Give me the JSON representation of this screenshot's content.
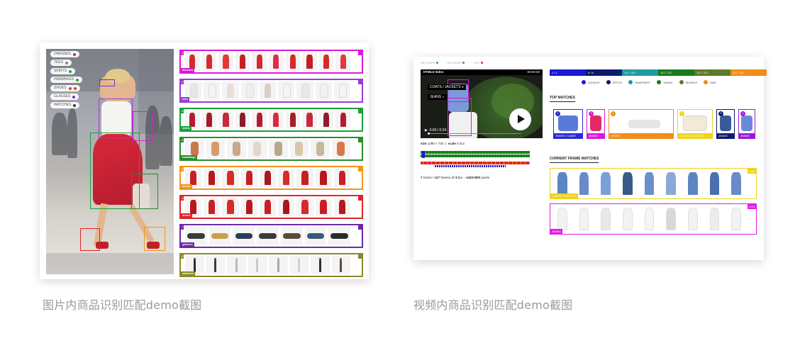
{
  "captions": {
    "image_demo": "图片内商品识别匹配demo截图",
    "video_demo": "视频内商品识别匹配demo截图"
  },
  "image_demo": {
    "tags": [
      {
        "label": "DRESSES",
        "color": "#e0157a"
      },
      {
        "label": "TEES",
        "color": "#8a8a8a"
      },
      {
        "label": "SKIRTS",
        "color": "#1aa52b"
      },
      {
        "label": "HANDBAGS",
        "color": "#2aa52b"
      },
      {
        "label": "SHOES",
        "color": "#e63a1a"
      },
      {
        "label": "GLASSES",
        "color": "#7b2ad1"
      },
      {
        "label": "WATCHES",
        "color": "#3a3a3a"
      }
    ],
    "rows": [
      {
        "label": "dresses",
        "color": "#d81ad8",
        "item": "#d62a2a"
      },
      {
        "label": "tees",
        "color": "#9a3ad8",
        "item": "#e8e8e8"
      },
      {
        "label": "skirts",
        "color": "#17a238",
        "item": "#b31c2e"
      },
      {
        "label": "handbags",
        "color": "#2a8c2a",
        "item": "#c8a98a"
      },
      {
        "label": "shoes",
        "color": "#f39418",
        "item": "#c71f25"
      },
      {
        "label": "shoes",
        "color": "#e3232a",
        "item": "#b8171d"
      },
      {
        "label": "glasses",
        "color": "#6b2aa8",
        "item": "#3a3a3a"
      },
      {
        "label": "watches",
        "color": "#8a8a2a",
        "item": "#2e2e2e"
      }
    ]
  },
  "video_demo": {
    "top_legend": [
      {
        "label": "NETWORK",
        "color": "#2aa52b"
      },
      {
        "label": "DECODER",
        "color": "#2aa52b"
      },
      {
        "label": "GPU",
        "color": "#e3232a"
      }
    ],
    "video": {
      "title": "HTML5 Video",
      "timecode": "00:00:02",
      "playback": "0:00 / 0:24",
      "tags": [
        "COATS / JACKETS",
        "JEANS"
      ]
    },
    "size_line": {
      "size_label": "size",
      "size": "1280 × 720",
      "scale_label": "scale",
      "scale": "0.31x"
    },
    "stats_line": {
      "tracks": "7",
      "tracks_label": "tracks",
      "frames": "127",
      "frames_label": "frames @",
      "fps": "5",
      "fps_label": "fps",
      "dims": "1422×800",
      "pixels_label": "pixels"
    },
    "status_segments": [
      {
        "label": "1 / 1",
        "color": "#1a1ad1"
      },
      {
        "label": "6 / 6",
        "color": "#0d1a6b"
      },
      {
        "label": "127 / 127",
        "color": "#1f9aa0"
      },
      {
        "label": "127 / 127",
        "color": "#1a7a1a"
      },
      {
        "label": "127 / 127",
        "color": "#5c7a2a"
      },
      {
        "label": "127 / 127",
        "color": "#f08c18"
      }
    ],
    "mode_legend": [
      {
        "label": "LOOKUP",
        "color": "#1a1ad1"
      },
      {
        "label": "FETCH",
        "color": "#0d1a6b"
      },
      {
        "label": "SNAPSHOT",
        "color": "#1f9aa0"
      },
      {
        "label": "TRACK",
        "color": "#1a7a1a"
      },
      {
        "label": "SEARCH",
        "color": "#5c7a2a"
      },
      {
        "label": "MAP",
        "color": "#f08c18"
      }
    ],
    "top_matches_title": "TOP MATCHES",
    "top_matches": [
      {
        "label": "TANKS / CAMIS",
        "color": "#2a2ad1",
        "item": "#5a7ad8"
      },
      {
        "label": "JEANS",
        "color": "#d81ad8",
        "item": "#e02a6a"
      },
      {
        "label": "SHOES",
        "color": "#f08c18",
        "item": "#e6e6e6"
      },
      {
        "label": "COATS / JACKETS",
        "color": "#f0d21a",
        "item": "#f0ead8"
      },
      {
        "label": "JEANS",
        "color": "#0d1a6b",
        "item": "#3a5a9a"
      },
      {
        "label": "JEANS",
        "color": "#9a1ad8",
        "item": "#6a8ad8"
      }
    ],
    "current_frame_title": "CURRENT FRAME MATCHES",
    "current_rows": [
      {
        "label": "COATS / JACKETS",
        "color": "#f0d21a",
        "score": "0.00",
        "item": "#5b86c4"
      },
      {
        "label": "JEANS",
        "color": "#e31ae3",
        "score": "0.03",
        "item": "#f2f2f2"
      }
    ]
  }
}
